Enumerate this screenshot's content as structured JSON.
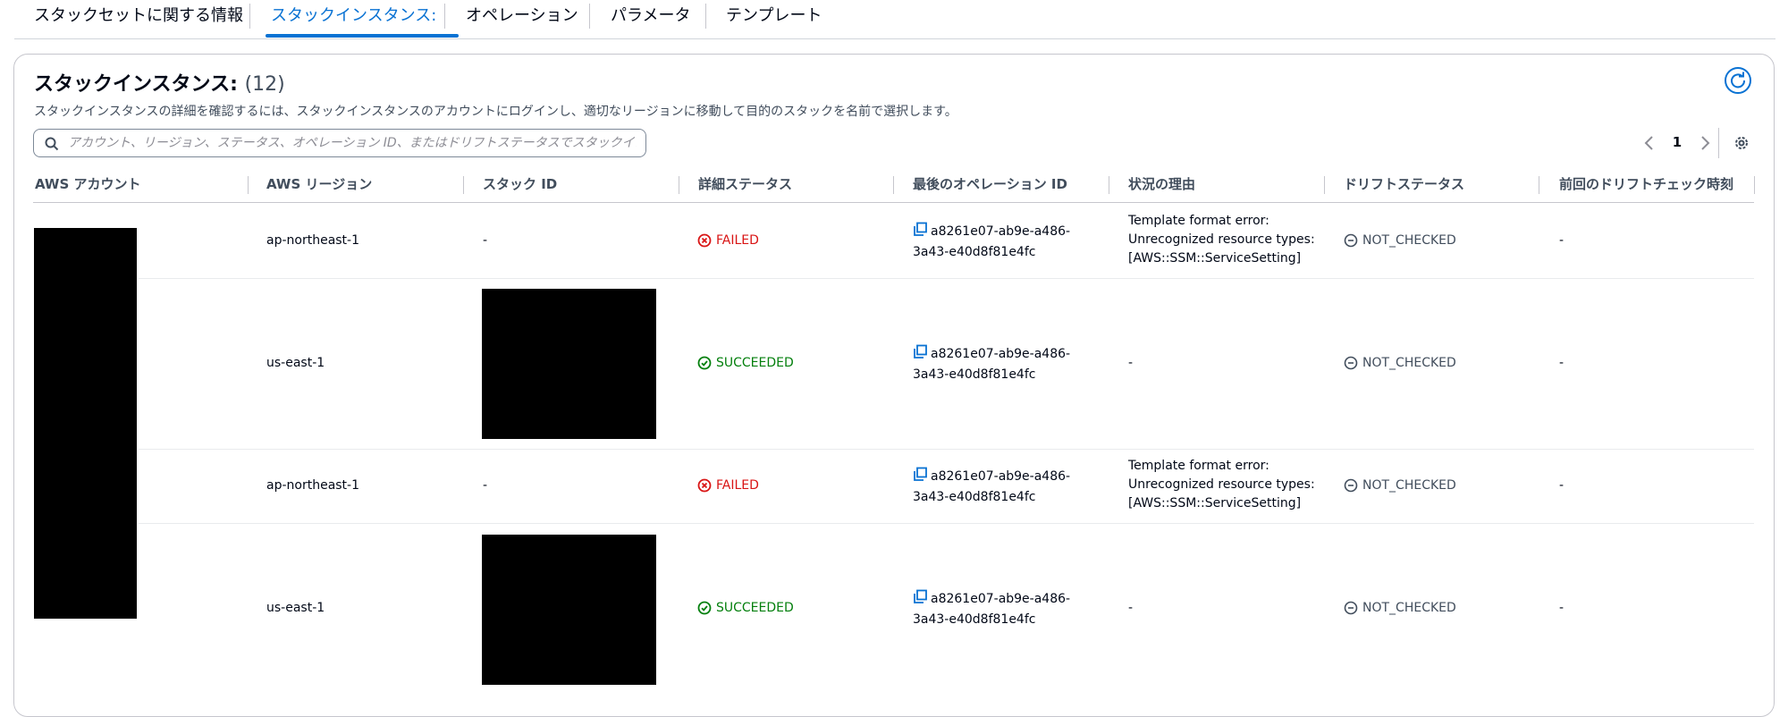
{
  "tabs": [
    {
      "label": "スタックセットに関する情報"
    },
    {
      "label": "スタックインスタンス:"
    },
    {
      "label": "オペレーション"
    },
    {
      "label": "パラメータ"
    },
    {
      "label": "テンプレート"
    }
  ],
  "panel": {
    "title": "スタックインスタンス:",
    "count": "(12)",
    "description": "スタックインスタンスの詳細を確認するには、スタックインスタンスのアカウントにログインし、適切なリージョンに移動して目的のスタックを名前で選択します。",
    "search_placeholder": "アカウント、リージョン、ステータス、オペレーション ID、またはドリフトステータスでスタックインスタンスを検索",
    "page": "1"
  },
  "columns": [
    {
      "label": "AWS アカウント"
    },
    {
      "label": "AWS リージョン"
    },
    {
      "label": "スタック ID"
    },
    {
      "label": "詳細ステータス"
    },
    {
      "label": "最後のオペレーション ID"
    },
    {
      "label": "状況の理由"
    },
    {
      "label": "ドリフトステータス"
    },
    {
      "label": "前回のドリフトチェック時刻"
    }
  ],
  "rows": [
    {
      "region": "ap-northeast-1",
      "stack_id": "-",
      "status": "FAILED",
      "op_id_1": "a8261e07-ab9e-a486-",
      "op_id_2": "3a43-e40d8f81e4fc",
      "reason_1": "Template format error:",
      "reason_2": "Unrecognized resource types:",
      "reason_3": "[AWS::SSM::ServiceSetting]",
      "drift": "NOT_CHECKED",
      "last_drift": "-"
    },
    {
      "region": "us-east-1",
      "stack_id": "",
      "status": "SUCCEEDED",
      "op_id_1": "a8261e07-ab9e-a486-",
      "op_id_2": "3a43-e40d8f81e4fc",
      "reason": "-",
      "drift": "NOT_CHECKED",
      "last_drift": "-"
    },
    {
      "region": "ap-northeast-1",
      "stack_id": "-",
      "status": "FAILED",
      "op_id_1": "a8261e07-ab9e-a486-",
      "op_id_2": "3a43-e40d8f81e4fc",
      "reason_1": "Template format error:",
      "reason_2": "Unrecognized resource types:",
      "reason_3": "[AWS::SSM::ServiceSetting]",
      "drift": "NOT_CHECKED",
      "last_drift": "-"
    },
    {
      "region": "us-east-1",
      "stack_id": "",
      "status": "SUCCEEDED",
      "op_id_1": "a8261e07-ab9e-a486-",
      "op_id_2": "3a43-e40d8f81e4fc",
      "reason": "-",
      "drift": "NOT_CHECKED",
      "last_drift": "-"
    }
  ]
}
